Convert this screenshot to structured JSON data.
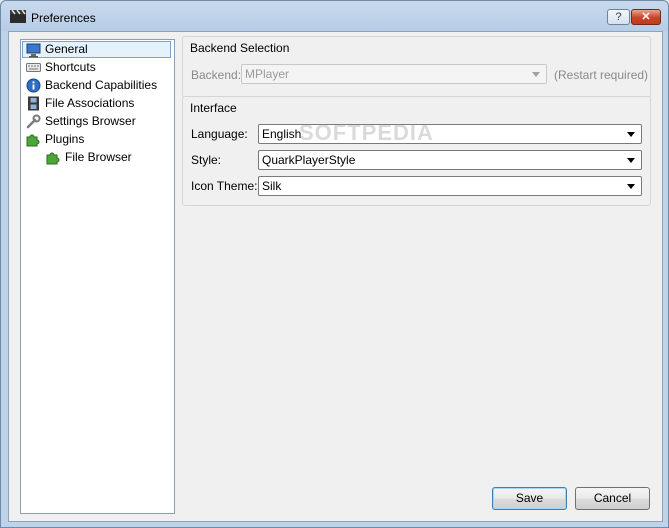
{
  "window": {
    "title": "Preferences",
    "help_glyph": "?",
    "close_glyph": "✕"
  },
  "nav": {
    "items": [
      {
        "label": "General",
        "icon": "monitor-icon"
      },
      {
        "label": "Shortcuts",
        "icon": "keyboard-icon"
      },
      {
        "label": "Backend Capabilities",
        "icon": "info-icon"
      },
      {
        "label": "File Associations",
        "icon": "film-icon"
      },
      {
        "label": "Settings Browser",
        "icon": "wrench-icon"
      },
      {
        "label": "Plugins",
        "icon": "puzzle-icon"
      },
      {
        "label": "File Browser",
        "icon": "puzzle-icon"
      }
    ],
    "selected": "General"
  },
  "backend": {
    "group_title": "Backend Selection",
    "label": "Backend:",
    "value": "MPlayer",
    "note": "(Restart required)"
  },
  "interface": {
    "group_title": "Interface",
    "language_label": "Language:",
    "language_value": "English",
    "style_label": "Style:",
    "style_value": "QuarkPlayerStyle",
    "icon_theme_label": "Icon Theme:",
    "icon_theme_value": "Silk"
  },
  "buttons": {
    "save": "Save",
    "cancel": "Cancel"
  },
  "watermark": "SOFTPEDIA"
}
